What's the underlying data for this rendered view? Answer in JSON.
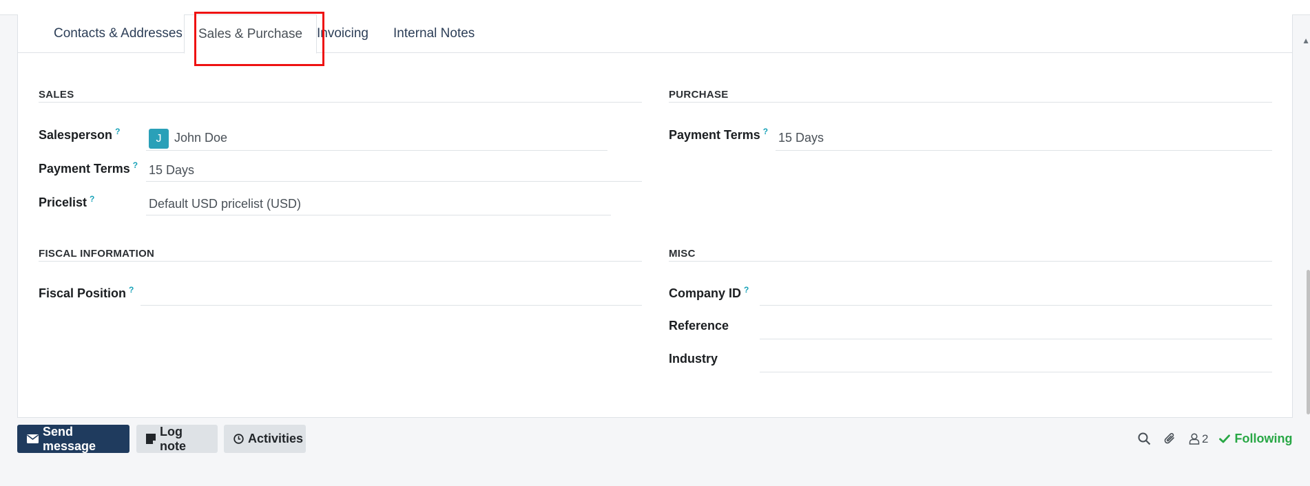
{
  "tabs": [
    {
      "label": "Contacts & Addresses"
    },
    {
      "label": "Sales & Purchase"
    },
    {
      "label": "Invoicing"
    },
    {
      "label": "Internal Notes"
    }
  ],
  "sales": {
    "title": "SALES",
    "salesperson_label": "Salesperson",
    "salesperson_initial": "J",
    "salesperson_value": "John Doe",
    "payment_terms_label": "Payment Terms",
    "payment_terms_value": "15 Days",
    "pricelist_label": "Pricelist",
    "pricelist_value": "Default USD pricelist (USD)"
  },
  "purchase": {
    "title": "PURCHASE",
    "payment_terms_label": "Payment Terms",
    "payment_terms_value": "15 Days"
  },
  "fiscal": {
    "title": "FISCAL INFORMATION",
    "fiscal_position_label": "Fiscal Position",
    "fiscal_position_value": ""
  },
  "misc": {
    "title": "MISC",
    "company_id_label": "Company ID",
    "company_id_value": "",
    "reference_label": "Reference",
    "reference_value": "",
    "industry_label": "Industry",
    "industry_value": ""
  },
  "help_mark": "?",
  "chatter": {
    "send_message": "Send message",
    "log_note": "Log note",
    "activities": "Activities",
    "followers_count": "2",
    "following": "Following"
  },
  "colors": {
    "primary": "#1f3b5e",
    "accent": "#17a2b8",
    "success": "#28a745",
    "highlight": "#ee1111"
  }
}
